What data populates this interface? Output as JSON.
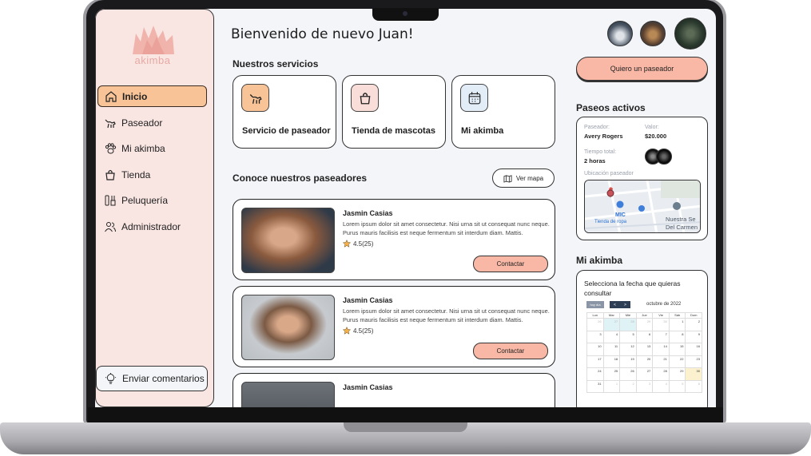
{
  "app": {
    "logo_text": "akimba",
    "welcome": "Bienvenido de nuevo Juan!"
  },
  "sidebar": {
    "items": [
      {
        "label": "Inicio",
        "icon": "home-icon",
        "active": true
      },
      {
        "label": "Paseador",
        "icon": "dog-walker-icon",
        "active": false
      },
      {
        "label": "Mi akimba",
        "icon": "paw-icon",
        "active": false
      },
      {
        "label": "Tienda",
        "icon": "bag-icon",
        "active": false
      },
      {
        "label": "Peluquería",
        "icon": "grooming-icon",
        "active": false
      },
      {
        "label": "Administrador",
        "icon": "users-icon",
        "active": false
      }
    ],
    "feedback": "Enviar comentarios"
  },
  "services": {
    "title": "Nuestros servicios",
    "items": [
      {
        "label": "Servicio de paseador",
        "icon": "dog-walker-icon",
        "color": "#f7c397"
      },
      {
        "label": "Tienda de mascotas",
        "icon": "bag-icon",
        "color": "#f9ddd8"
      },
      {
        "label": "Mi akimba",
        "icon": "calendar-icon",
        "color": "#e2edf8"
      }
    ]
  },
  "walkers": {
    "title": "Conoce nuestros paseadores",
    "map_button": "Ver mapa",
    "items": [
      {
        "name": "Jasmin Casias",
        "desc": "Lorem ipsum dolor sit amet consectetur. Nisi urna sit ut consequat nunc neque. Purus mauris facilisis est neque fermentum sit interdum diam. Mattis.",
        "rating": "4.5",
        "reviews": "(25)",
        "contact": "Contactar"
      },
      {
        "name": "Jasmin Casias",
        "desc": "Lorem ipsum dolor sit amet consectetur. Nisi urna sit ut consequat nunc neque. Purus mauris facilisis est neque fermentum sit interdum diam. Mattis.",
        "rating": "4.5",
        "reviews": "(25)",
        "contact": "Contactar"
      },
      {
        "name": "Jasmin Casias"
      }
    ]
  },
  "right": {
    "want_walker": "Quiero un paseador",
    "active_title": "Paseos activos",
    "walker_label": "Paseador:",
    "walker_value": "Avery Rogers",
    "price_label": "Valor:",
    "price_value": "$20.000",
    "time_label": "Tiempo total:",
    "time_value": "2 horas",
    "location_label": "Ubicación paseador",
    "map_labels": {
      "place1": "MIC",
      "place2": "Tienda de ropa",
      "place3": "Nuestra Se",
      "place4": "Del Carmen"
    },
    "akimba_title": "Mi akimba",
    "calendar_prompt": "Selecciona la fecha que quieras consultar",
    "calendar": {
      "today_btn": "hoy día",
      "prev": "<",
      "next": ">",
      "month": "octubre de 2022",
      "dow": [
        "Lun",
        "Mar",
        "Mié",
        "Jue",
        "Vie",
        "Sáb",
        "Dom"
      ],
      "days": [
        "26",
        "27",
        "28",
        "29",
        "30",
        "1",
        "2",
        "3",
        "4",
        "5",
        "6",
        "7",
        "8",
        "9",
        "10",
        "11",
        "12",
        "13",
        "14",
        "15",
        "16",
        "17",
        "18",
        "19",
        "20",
        "21",
        "22",
        "23",
        "24",
        "25",
        "26",
        "27",
        "28",
        "29",
        "30",
        "31",
        "1",
        "2",
        "3",
        "4",
        "5",
        "6"
      ]
    }
  }
}
